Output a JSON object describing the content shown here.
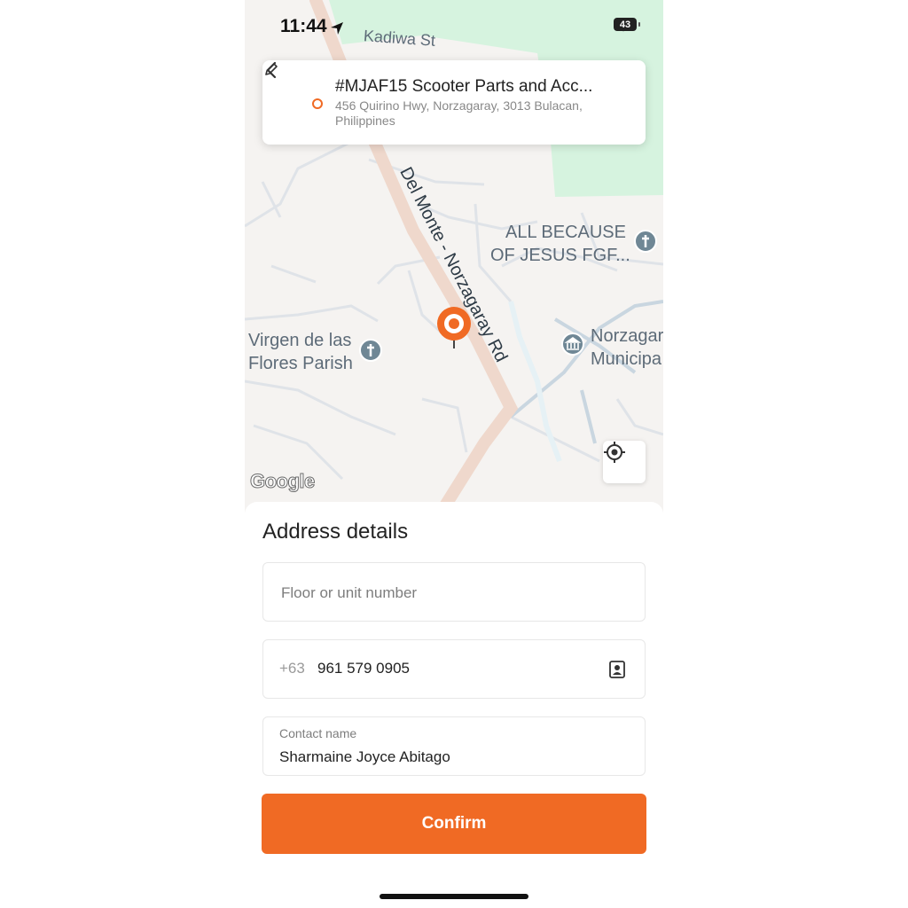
{
  "status_bar": {
    "time": "11:44",
    "battery": "43"
  },
  "map": {
    "labels": {
      "kadiwa": "Kadiwa St",
      "road": "Del Monte - Norzagaray Rd",
      "church1_line1": "ALL BECAUSE",
      "church1_line2": "OF JESUS FGF...",
      "church2_line1": "Virgen de las",
      "church2_line2": "Flores Parish",
      "muni_line1": "Norzagar",
      "muni_line2": "Municipa"
    },
    "attribution": "Google",
    "icons": [
      "church-icon",
      "municipal-hall-icon",
      "location-pin-icon",
      "my-location-icon"
    ]
  },
  "address_card": {
    "title": "#MJAF15 Scooter Parts and Acc...",
    "subtitle": "456 Quirino Hwy, Norzagaray, 3013 Bulacan, Philippines"
  },
  "sheet": {
    "title": "Address details",
    "floor_placeholder": "Floor or unit number",
    "country_code": "+63",
    "phone": "961 579 0905",
    "contact_label": "Contact name",
    "contact_name": "Sharmaine Joyce Abitago",
    "confirm_label": "Confirm"
  },
  "colors": {
    "accent": "#f06a24",
    "map_bg": "#f5f3f1",
    "park": "#d6f3df",
    "road": "#efd8cc"
  }
}
